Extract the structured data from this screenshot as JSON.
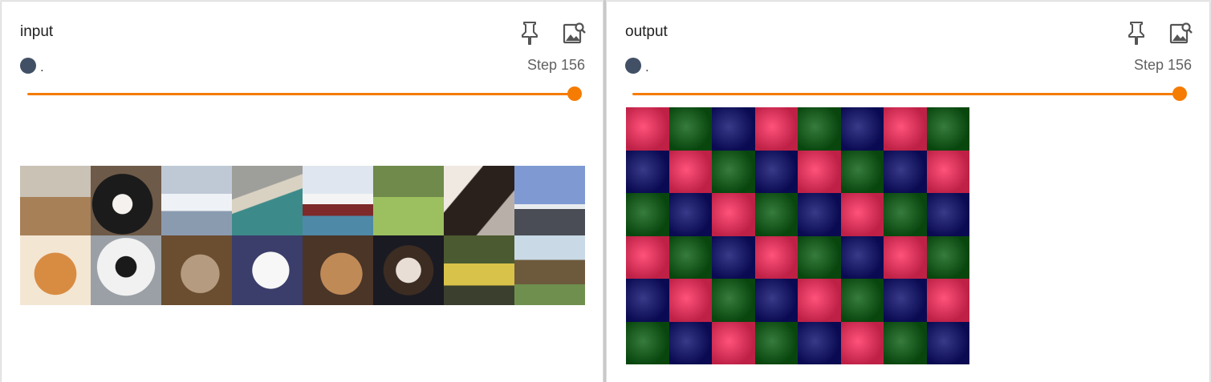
{
  "colors": {
    "accent": "#f57c00",
    "run_dot": "#425066",
    "out_red": "#ff2c5e",
    "out_green": "#0b5e12",
    "out_blue": "#0d0e6e"
  },
  "panels": [
    {
      "title": "input",
      "run_label": ".",
      "step_label": "Step 156",
      "slider_value": 1.0,
      "icons": [
        "pin-icon",
        "image-search-icon"
      ],
      "grid_cols": 8,
      "grid_rows": 2,
      "image_subjects": [
        "horse with rider",
        "black and white dog",
        "white boat",
        "airplane over water",
        "ship",
        "deer in grass",
        "horse",
        "airplane",
        "orange cat",
        "dog on bed",
        "tabby cat",
        "white cat",
        "brown dog",
        "small dog",
        "yellow car",
        "horse in field"
      ]
    },
    {
      "title": "output",
      "run_label": ".",
      "step_label": "Step 156",
      "slider_value": 1.0,
      "icons": [
        "pin-icon",
        "image-search-icon"
      ],
      "grid_cols": 8,
      "grid_rows": 6,
      "tile_colors": [
        "red",
        "green",
        "blue",
        "red",
        "green",
        "blue",
        "red",
        "green",
        "blue",
        "red",
        "green",
        "blue",
        "red",
        "green",
        "blue",
        "red",
        "green",
        "blue",
        "red",
        "green",
        "blue",
        "red",
        "green",
        "blue",
        "red",
        "green",
        "blue",
        "red",
        "green",
        "blue",
        "red",
        "green",
        "blue",
        "red",
        "green",
        "blue",
        "red",
        "green",
        "blue",
        "red",
        "green",
        "blue",
        "red",
        "green",
        "blue",
        "red",
        "green",
        "blue"
      ]
    }
  ]
}
